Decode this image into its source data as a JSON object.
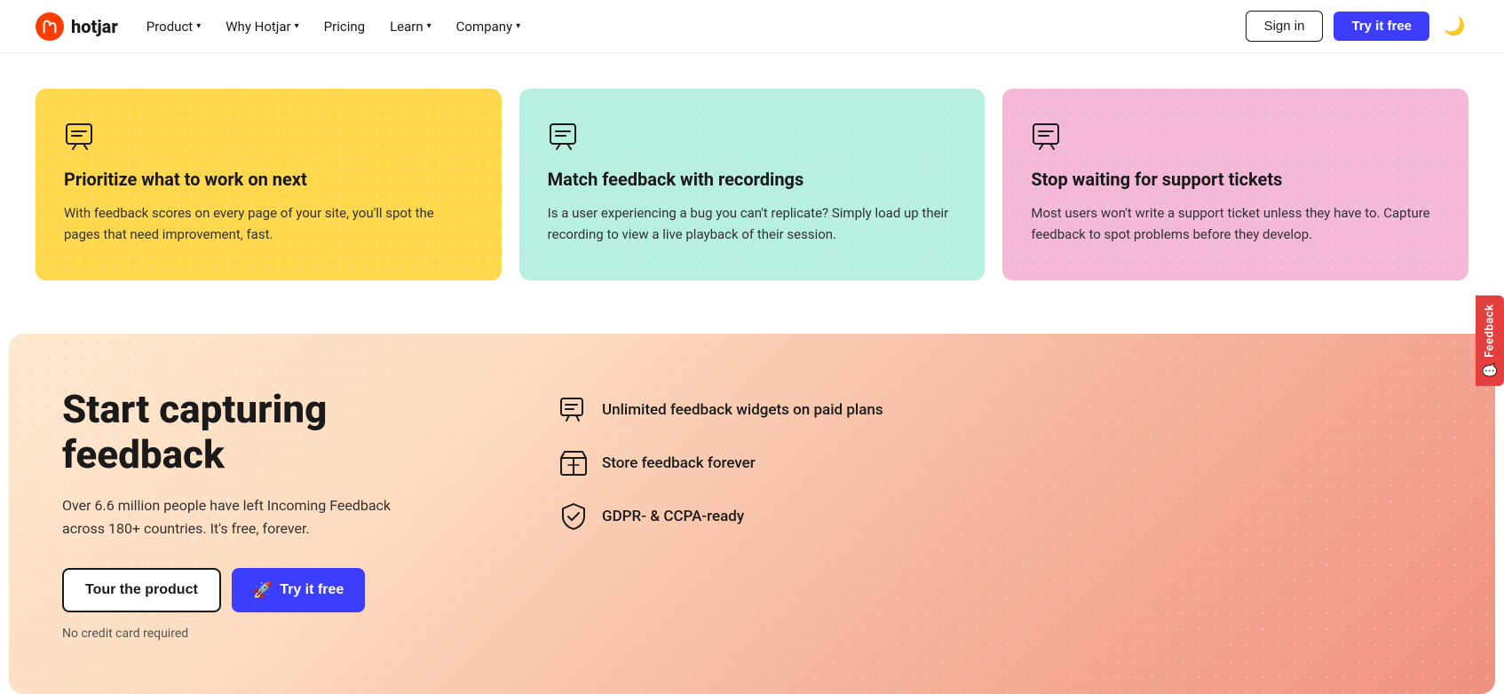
{
  "brand": {
    "name": "hotjar",
    "logo_text": "hotjar"
  },
  "nav": {
    "links": [
      {
        "id": "product",
        "label": "Product",
        "has_dropdown": true
      },
      {
        "id": "why-hotjar",
        "label": "Why Hotjar",
        "has_dropdown": true
      },
      {
        "id": "pricing",
        "label": "Pricing",
        "has_dropdown": false
      },
      {
        "id": "learn",
        "label": "Learn",
        "has_dropdown": true
      },
      {
        "id": "company",
        "label": "Company",
        "has_dropdown": true
      }
    ],
    "signin_label": "Sign in",
    "try_label": "Try it free",
    "dark_mode_icon": "🌙"
  },
  "cards": [
    {
      "id": "card-prioritize",
      "color": "yellow",
      "icon": "chat-icon",
      "title": "Prioritize what to work on next",
      "desc": "With feedback scores on every page of your site, you'll spot the pages that need improvement, fast."
    },
    {
      "id": "card-match",
      "color": "teal",
      "icon": "chat-icon",
      "title": "Match feedback with recordings",
      "desc": "Is a user experiencing a bug you can't replicate? Simply load up their recording to view a live playback of their session."
    },
    {
      "id": "card-support",
      "color": "pink",
      "icon": "chat-icon",
      "title": "Stop waiting for support tickets",
      "desc": "Most users won't write a support ticket unless they have to. Capture feedback to spot problems before they develop."
    }
  ],
  "cta": {
    "title": "Start capturing feedback",
    "desc": "Over 6.6 million people have left Incoming Feedback across 180+ countries. It's free, forever.",
    "tour_label": "Tour the product",
    "try_label": "Try it free",
    "no_cc": "No credit card required",
    "features": [
      {
        "id": "widgets",
        "icon": "feedback-widget-icon",
        "text": "Unlimited feedback widgets on paid plans"
      },
      {
        "id": "store",
        "icon": "box-icon",
        "text": "Store feedback forever"
      },
      {
        "id": "gdpr",
        "icon": "shield-icon",
        "text": "GDPR- & CCPA-ready"
      }
    ]
  },
  "feedback_tab": {
    "label": "Feedback"
  }
}
